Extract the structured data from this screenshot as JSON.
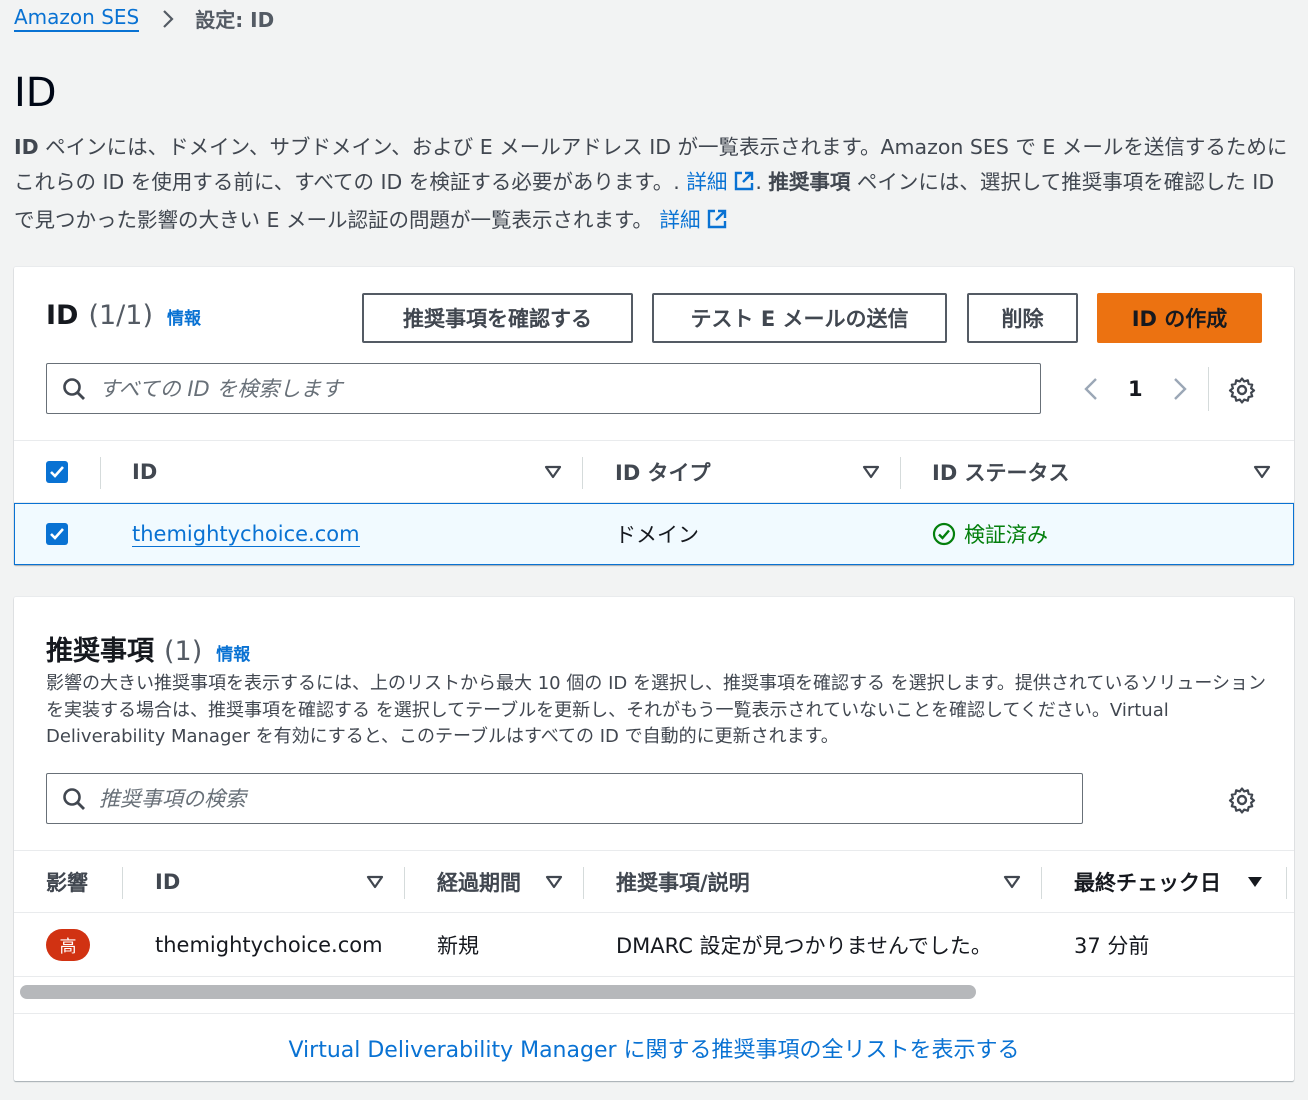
{
  "breadcrumb": {
    "parent": "Amazon SES",
    "current": "設定: ID"
  },
  "page": {
    "title": "ID",
    "desc_part1_bold": "ID",
    "desc_part1": " ペインには、ドメイン、サブドメイン、および E メールアドレス ID が一覧表示されます。Amazon SES で E メールを送信するためにこれらの ID を使用する前に、すべての ID を検証する必要があります。. ",
    "detail_link": "詳細",
    "desc_part2_bold": "推奨事項",
    "desc_part2": " ペインには、選択して推奨事項を確認した ID で見つかった影響の大きい E メール認証の問題が一覧表示されます。 "
  },
  "identities": {
    "title": "ID",
    "count": "(1/1)",
    "info": "情報",
    "buttons": {
      "review": "推奨事項を確認する",
      "test_email": "テスト E メールの送信",
      "delete": "削除",
      "create": "ID の作成"
    },
    "search_placeholder": "すべての ID を検索します",
    "page_number": "1",
    "columns": [
      "ID",
      "ID タイプ",
      "ID ステータス"
    ],
    "rows": [
      {
        "id": "themightychoice.com",
        "type": "ドメイン",
        "status": "検証済み"
      }
    ]
  },
  "recommendations": {
    "title": "推奨事項",
    "count": "(1)",
    "info": "情報",
    "description": "影響の大きい推奨事項を表示するには、上のリストから最大 10 個の ID を選択し、推奨事項を確認する を選択します。提供されているソリューションを実装する場合は、推奨事項を確認する を選択してテーブルを更新し、それがもう一覧表示されていないことを確認してください。Virtual Deliverability Manager を有効にすると、このテーブルはすべての ID で自動的に更新されます。",
    "search_placeholder": "推奨事項の検索",
    "columns": [
      "影響",
      "ID",
      "経過期間",
      "推奨事項/説明",
      "最終チェック日"
    ],
    "rows": [
      {
        "impact": "高",
        "id": "themightychoice.com",
        "age": "新規",
        "description": "DMARC 設定が見つかりませんでした。",
        "last_checked": "37 分前"
      }
    ],
    "footer_link": "Virtual Deliverability Manager に関する推奨事項の全リストを表示する"
  },
  "colors": {
    "link": "#0972d3",
    "primary_button": "#ec7211",
    "success": "#037f0c",
    "badge_high": "#d13212"
  }
}
